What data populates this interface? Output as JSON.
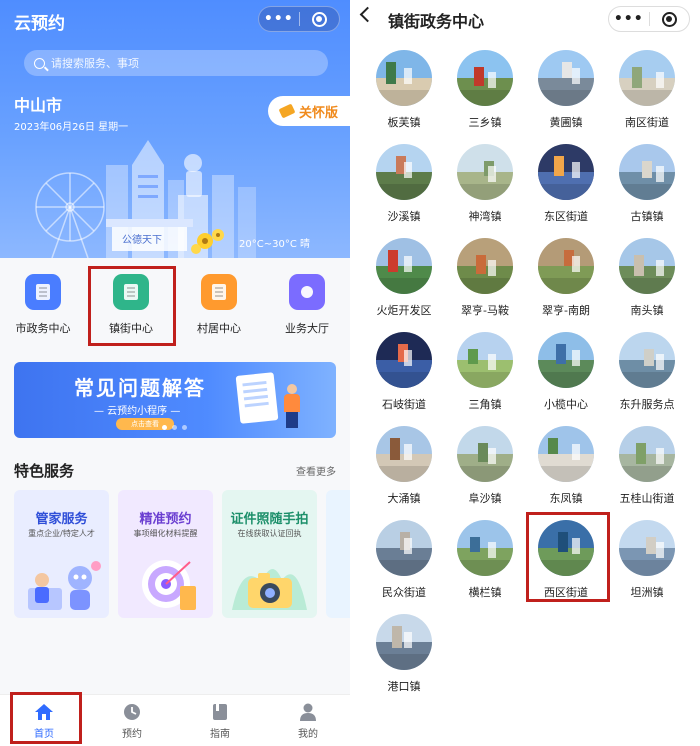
{
  "left": {
    "app_title": "云预约",
    "search_placeholder": "请搜索服务、事项",
    "city": "中山市",
    "date": "2023年06月26日 星期一",
    "care_mode": "关怀版",
    "weather": "20°C~30°C 晴",
    "sign_text": "公德天下",
    "quick_items": [
      {
        "label": "市政务中心",
        "color": "#4a7dff"
      },
      {
        "label": "镇街中心",
        "color": "#2fb58a"
      },
      {
        "label": "村居中心",
        "color": "#ff9a2e"
      },
      {
        "label": "业务大厅",
        "color": "#7b6cff"
      }
    ],
    "banner": {
      "title": "常见问题解答",
      "subtitle": "— 云预约小程序 —",
      "button": "点击查看"
    },
    "featured": {
      "title": "特色服务",
      "more": "查看更多",
      "cards": [
        {
          "title": "管家服务",
          "subtitle": "重点企业/特定人才",
          "bg": "#e9edff",
          "title_color": "#2f4fd8"
        },
        {
          "title": "精准预约",
          "subtitle": "事项细化材料提醒",
          "bg": "#f1e9ff",
          "title_color": "#6b3fd1"
        },
        {
          "title": "证件照随手拍",
          "subtitle": "在线获取认证回执",
          "bg": "#e4f6f1",
          "title_color": "#1c8f6a"
        }
      ]
    },
    "tabs": [
      {
        "label": "首页",
        "icon": "home-icon"
      },
      {
        "label": "预约",
        "icon": "clock-icon"
      },
      {
        "label": "指南",
        "icon": "book-icon"
      },
      {
        "label": "我的",
        "icon": "user-icon"
      }
    ]
  },
  "right": {
    "title": "镇街政务中心",
    "towns": [
      "板芙镇",
      "三乡镇",
      "黄圃镇",
      "南区街道",
      "沙溪镇",
      "神湾镇",
      "东区街道",
      "古镇镇",
      "火炬开发区",
      "翠亨-马鞍",
      "翠亨-南朗",
      "南头镇",
      "石岐街道",
      "三角镇",
      "小榄中心",
      "东升服务点",
      "大涌镇",
      "阜沙镇",
      "东凤镇",
      "五桂山街道",
      "民众街道",
      "横栏镇",
      "西区街道",
      "坦洲镇",
      "港口镇"
    ]
  },
  "colors": {
    "accent": "#2f6bff",
    "highlight": "#c0201c"
  }
}
